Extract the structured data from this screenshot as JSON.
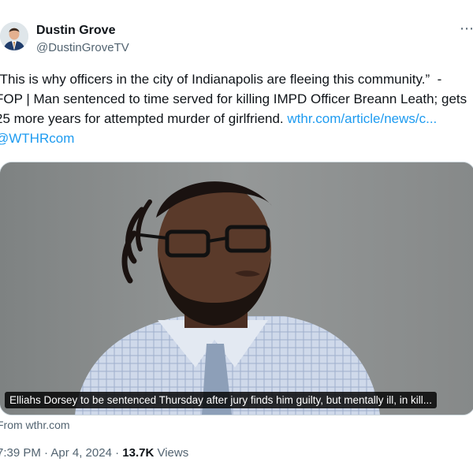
{
  "header": {
    "name": "Dustin Grove",
    "handle": "@DustinGroveTV",
    "avatar_icon": "person-avatar-icon",
    "more_icon": "more-horizontal-icon"
  },
  "tweet": {
    "text": "“This is why officers in the city of Indianapolis are fleeing this community.”  - FOP | Man sentenced to time served for killing IMPD Officer Breann Leath; gets 25 more years for attempted murder of girlfriend. ",
    "link_text": "wthr.com/article/news/c...",
    "mention": "@WTHRcom"
  },
  "media": {
    "caption": "Elliahs Dorsey to be sentenced Thursday after jury finds him guilty, but mentally ill, in kill...",
    "source": "From wthr.com"
  },
  "meta": {
    "time_date": "7:39 PM · Apr 4, 2024 · ",
    "views_count": "13.7K",
    "views_label": " Views"
  }
}
